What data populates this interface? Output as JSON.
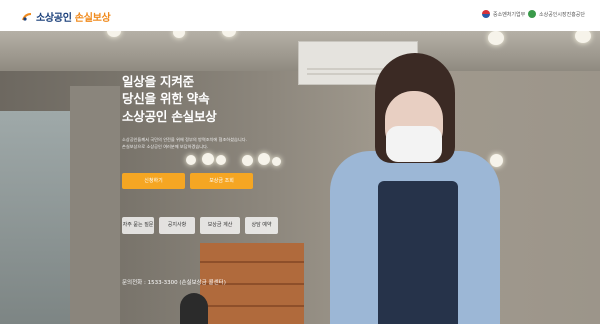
{
  "header": {
    "logo_text_a": "소상공인",
    "logo_text_b": "손실보상",
    "gov_1": "중소벤처기업부",
    "gov_2": "소상공인시장진흥공단"
  },
  "hero": {
    "title_lines": [
      "일상을 지켜준",
      "당신을 위한 약속",
      "소상공인 손실보상"
    ],
    "description_lines": [
      "소상공인들께서 국민의 안전을 위해 정부의 방역조치에 협조하셨습니다.",
      "손실보상으로 소상공인 여러분께 보답하겠습니다."
    ],
    "buttons": [
      "신청하기",
      "보상금 조회"
    ],
    "quick_links": [
      "자주 묻는 질문",
      "공지사항",
      "보상금 계산",
      "상담 예약"
    ],
    "phone_text": "문의전화 : 1533-3300 (손실보상금 콜센터)"
  },
  "colors": {
    "accent": "#f5a623",
    "brand_blue": "#1a3f7a",
    "brand_orange": "#f08a1c"
  }
}
